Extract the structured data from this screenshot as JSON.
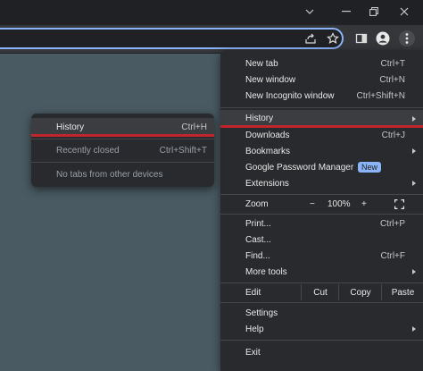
{
  "window": {
    "icons": [
      "chevron-down-icon",
      "minimize-icon",
      "restore-icon",
      "close-icon"
    ]
  },
  "toolbar": {
    "icons": [
      "share-icon",
      "bookmark-star-icon",
      "side-panel-icon",
      "profile-icon",
      "kebab-menu-icon"
    ]
  },
  "main_menu": {
    "new_tab": {
      "label": "New tab",
      "shortcut": "Ctrl+T"
    },
    "new_window": {
      "label": "New window",
      "shortcut": "Ctrl+N"
    },
    "new_incognito": {
      "label": "New Incognito window",
      "shortcut": "Ctrl+Shift+N"
    },
    "history": {
      "label": "History"
    },
    "downloads": {
      "label": "Downloads",
      "shortcut": "Ctrl+J"
    },
    "bookmarks": {
      "label": "Bookmarks"
    },
    "password_manager": {
      "label": "Google Password Manager",
      "badge": "New"
    },
    "extensions": {
      "label": "Extensions"
    },
    "zoom": {
      "label": "Zoom",
      "minus": "−",
      "value": "100%",
      "plus": "+"
    },
    "print": {
      "label": "Print...",
      "shortcut": "Ctrl+P"
    },
    "cast": {
      "label": "Cast..."
    },
    "find": {
      "label": "Find...",
      "shortcut": "Ctrl+F"
    },
    "more_tools": {
      "label": "More tools"
    },
    "edit": {
      "label": "Edit",
      "cut": "Cut",
      "copy": "Copy",
      "paste": "Paste"
    },
    "settings": {
      "label": "Settings"
    },
    "help": {
      "label": "Help"
    },
    "exit": {
      "label": "Exit"
    }
  },
  "history_submenu": {
    "history": {
      "label": "History",
      "shortcut": "Ctrl+H"
    },
    "recently_closed": {
      "label": "Recently closed",
      "shortcut": "Ctrl+Shift+T"
    },
    "no_tabs": {
      "label": "No tabs from other devices"
    }
  },
  "colors": {
    "highlight_underline": "#c0262b",
    "new_badge": "#8ab4f8",
    "omnibox_focus": "#8ab4f8"
  }
}
